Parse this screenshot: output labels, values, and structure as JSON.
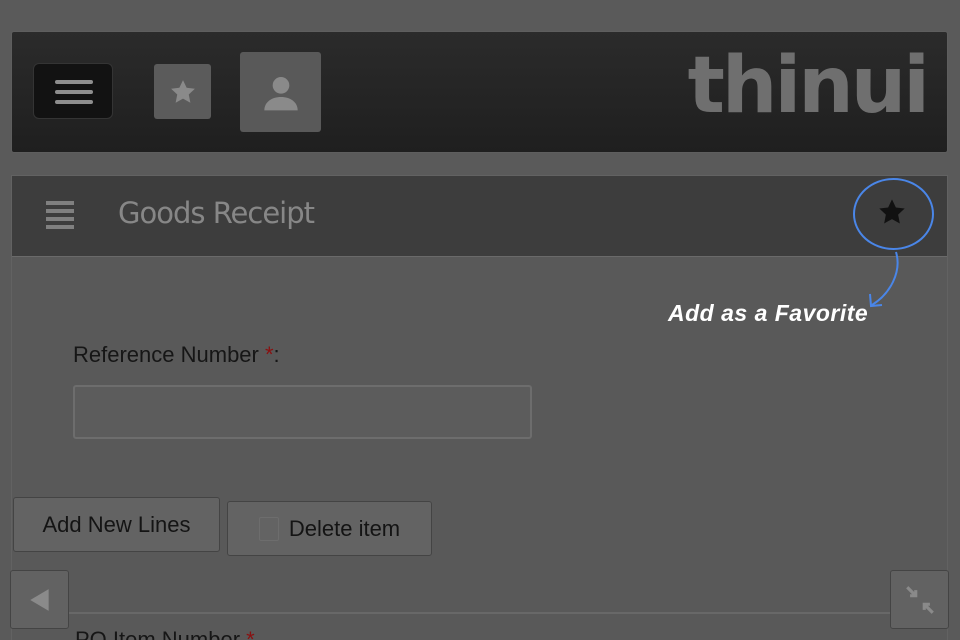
{
  "app": {
    "logo_text": "thinui"
  },
  "topbar": {
    "menu_icon": "hamburger-icon",
    "favorites_icon": "star-icon",
    "user_icon": "user-icon"
  },
  "page": {
    "title": "Goods Receipt",
    "fields": {
      "reference_number": {
        "label": "Reference Number ",
        "required_mark": "*",
        "suffix": ":",
        "value": ""
      },
      "po_item_number": {
        "label": "PO Item Number ",
        "required_mark": "*"
      }
    },
    "buttons": {
      "add_new_lines": "Add New Lines",
      "delete_item": "Delete item"
    }
  },
  "tutorial": {
    "favorite_tip": "Add as a Favorite"
  },
  "colors": {
    "highlight_circle": "#4a86e8",
    "required": "#8a1010"
  }
}
